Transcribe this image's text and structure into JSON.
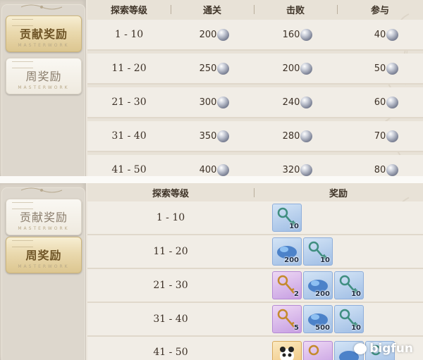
{
  "top_panel": {
    "tabs": [
      {
        "label": "贡献奖励",
        "sub": "MASTERWORK",
        "active": true
      },
      {
        "label": "周奖励",
        "sub": "MASTERWORK",
        "active": false
      }
    ],
    "headers": [
      "探索等级",
      "通关",
      "击败",
      "参与"
    ],
    "rows": [
      {
        "level": "1 - 10",
        "clear": "200",
        "defeat": "160",
        "join": "40"
      },
      {
        "level": "11 - 20",
        "clear": "250",
        "defeat": "200",
        "join": "50"
      },
      {
        "level": "21 - 30",
        "clear": "300",
        "defeat": "240",
        "join": "60"
      },
      {
        "level": "31 - 40",
        "clear": "350",
        "defeat": "280",
        "join": "70"
      },
      {
        "level": "41 - 50",
        "clear": "400",
        "defeat": "320",
        "join": "80"
      }
    ],
    "currency_icon": "silver-orb-icon"
  },
  "bottom_panel": {
    "tabs": [
      {
        "label": "贡献奖励",
        "sub": "MASTERWORK",
        "active": false
      },
      {
        "label": "周奖励",
        "sub": "MASTERWORK",
        "active": true
      }
    ],
    "headers": [
      "探索等级",
      "奖励"
    ],
    "rows": [
      {
        "level": "1 - 10",
        "rewards": [
          {
            "icon": "key-icon",
            "rarity": "blue",
            "qty": "10"
          }
        ]
      },
      {
        "level": "11 - 20",
        "rewards": [
          {
            "icon": "blue-crystal-icon",
            "rarity": "blue",
            "qty": "200"
          },
          {
            "icon": "key-icon",
            "rarity": "blue",
            "qty": "10"
          }
        ]
      },
      {
        "level": "21 - 30",
        "rewards": [
          {
            "icon": "gold-key-icon",
            "rarity": "purple",
            "qty": "2"
          },
          {
            "icon": "blue-crystal-icon",
            "rarity": "blue",
            "qty": "200"
          },
          {
            "icon": "key-icon",
            "rarity": "blue",
            "qty": "10"
          }
        ]
      },
      {
        "level": "31 - 40",
        "rewards": [
          {
            "icon": "gold-key-icon",
            "rarity": "purple",
            "qty": "5"
          },
          {
            "icon": "blue-crystal-icon",
            "rarity": "blue",
            "qty": "500"
          },
          {
            "icon": "key-icon",
            "rarity": "blue",
            "qty": "10"
          }
        ]
      },
      {
        "level": "41 - 50",
        "rewards": [
          {
            "icon": "panda-icon",
            "rarity": "gold",
            "qty": ""
          },
          {
            "icon": "gold-key-icon",
            "rarity": "purple",
            "qty": ""
          },
          {
            "icon": "blue-crystal-icon",
            "rarity": "blue",
            "qty": ""
          },
          {
            "icon": "key-icon",
            "rarity": "blue",
            "qty": ""
          }
        ]
      }
    ]
  },
  "watermark": "bigfun",
  "colors": {
    "accent_gold": "#dcc690",
    "row_bg": "#f1ede6",
    "rarity_blue": "#9fbde4",
    "rarity_purple": "#c69ee2",
    "rarity_gold": "#eec27a"
  }
}
